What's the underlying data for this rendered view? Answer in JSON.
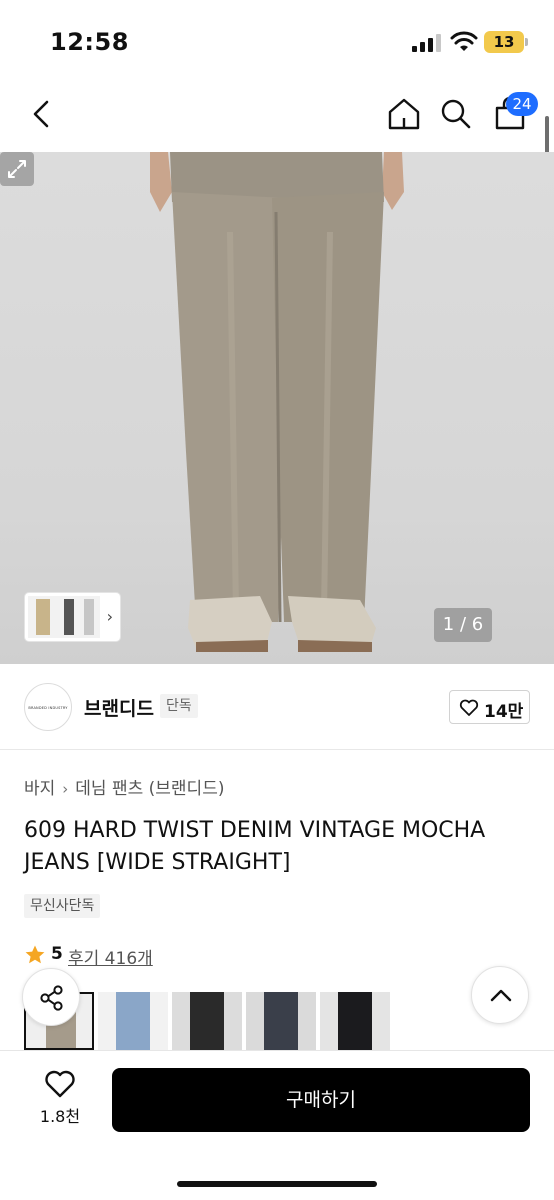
{
  "status_bar": {
    "time": "12:58",
    "battery": "13"
  },
  "nav": {
    "cart_count": "24"
  },
  "hero": {
    "page_indicator": "1 / 6"
  },
  "brand": {
    "name": "브랜디드",
    "tag": "단독",
    "logo_text": "BRANDED INDUSTRY",
    "likes": "14만"
  },
  "breadcrumb": {
    "category": "바지",
    "subcategory": "데님 팬츠 (브랜디드)"
  },
  "product": {
    "title": "609 HARD TWIST DENIM VINTAGE MOCHA JEANS [WIDE STRAIGHT]",
    "badge": "무신사단독",
    "rating": "5",
    "reviews": "후기 416개"
  },
  "variants": [
    {
      "name": "mocha",
      "color": "#a59b8b"
    },
    {
      "name": "light-blue",
      "color": "#8aa6c8"
    },
    {
      "name": "black",
      "color": "#2a2a2a"
    },
    {
      "name": "dark-navy",
      "color": "#3a3f4a"
    },
    {
      "name": "raw-black",
      "color": "#1b1b1e"
    }
  ],
  "bottom_bar": {
    "wish_count": "1.8천",
    "buy_label": "구매하기"
  },
  "colors": {
    "accent": "#1e6dff",
    "star": "#f5a623",
    "buy_button": "#000000"
  }
}
